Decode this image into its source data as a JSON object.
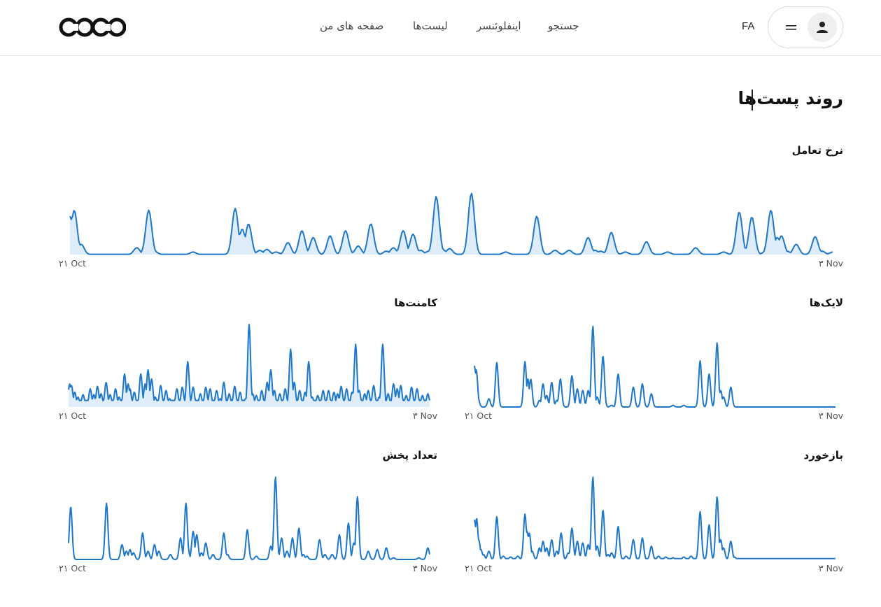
{
  "header": {
    "logo_text": "COCO",
    "nav": {
      "search": "جستجو",
      "influencer": "اینفلوئنسر",
      "lists": "لیست‌ها",
      "my_pages": "صفحه های من"
    },
    "language": "FA",
    "icons": {
      "menu": "hamburger-icon",
      "user": "user-icon"
    }
  },
  "page": {
    "title": "روند پست‌ها"
  },
  "colors": {
    "line": "#1f77c9",
    "fill": "#d6e8f8",
    "accent": "#111111"
  },
  "charts": [
    {
      "id": "engagement",
      "title": "نرخ تعامل",
      "x_start": "۲۱ Oct",
      "x_end": "۳ Nov",
      "chart_data": {
        "type": "area",
        "baseline": 0.3,
        "spikes": [
          [
            0.0,
            45
          ],
          [
            0.006,
            52
          ],
          [
            0.016,
            12
          ],
          [
            0.095,
            8
          ],
          [
            0.112,
            52
          ],
          [
            0.12,
            4
          ],
          [
            0.175,
            3
          ],
          [
            0.235,
            54
          ],
          [
            0.245,
            30
          ],
          [
            0.254,
            36
          ],
          [
            0.27,
            5
          ],
          [
            0.28,
            6
          ],
          [
            0.293,
            3
          ],
          [
            0.31,
            14
          ],
          [
            0.33,
            28
          ],
          [
            0.346,
            20
          ],
          [
            0.37,
            22
          ],
          [
            0.392,
            28
          ],
          [
            0.41,
            10
          ],
          [
            0.428,
            36
          ],
          [
            0.45,
            4
          ],
          [
            0.46,
            8
          ],
          [
            0.474,
            28
          ],
          [
            0.488,
            24
          ],
          [
            0.499,
            5
          ],
          [
            0.51,
            4
          ],
          [
            0.521,
            68
          ],
          [
            0.53,
            6
          ],
          [
            0.54,
            7
          ],
          [
            0.571,
            72
          ],
          [
            0.62,
            3
          ],
          [
            0.664,
            45
          ],
          [
            0.69,
            5
          ],
          [
            0.71,
            5
          ],
          [
            0.737,
            20
          ],
          [
            0.747,
            5
          ],
          [
            0.755,
            4
          ],
          [
            0.77,
            26
          ],
          [
            0.79,
            3
          ],
          [
            0.82,
            15
          ],
          [
            0.85,
            3
          ],
          [
            0.89,
            8
          ],
          [
            0.93,
            3
          ],
          [
            0.952,
            50
          ],
          [
            0.97,
            44
          ],
          [
            0.99,
            4
          ],
          [
            0.997,
            52
          ],
          [
            1.006,
            20
          ],
          [
            1.012,
            22
          ],
          [
            1.02,
            4
          ],
          [
            1.033,
            12
          ],
          [
            1.06,
            21
          ],
          [
            1.07,
            4
          ],
          [
            1.085,
            3
          ]
        ],
        "ylim": [
          0,
          100
        ]
      }
    },
    {
      "id": "likes",
      "title": "لایک‌ها",
      "x_start": "۲۱ Oct",
      "x_end": "۳ Nov",
      "chart_data": {
        "type": "line",
        "baseline": 0,
        "spikes": [
          [
            0.0,
            50
          ],
          [
            0.005,
            45
          ],
          [
            0.01,
            10
          ],
          [
            0.04,
            10
          ],
          [
            0.062,
            54
          ],
          [
            0.14,
            55
          ],
          [
            0.148,
            34
          ],
          [
            0.156,
            34
          ],
          [
            0.18,
            8
          ],
          [
            0.19,
            28
          ],
          [
            0.2,
            14
          ],
          [
            0.214,
            30
          ],
          [
            0.228,
            8
          ],
          [
            0.238,
            34
          ],
          [
            0.27,
            38
          ],
          [
            0.285,
            22
          ],
          [
            0.3,
            20
          ],
          [
            0.315,
            20
          ],
          [
            0.328,
            98
          ],
          [
            0.34,
            12
          ],
          [
            0.356,
            62
          ],
          [
            0.38,
            2
          ],
          [
            0.398,
            40
          ],
          [
            0.44,
            24
          ],
          [
            0.465,
            28
          ],
          [
            0.49,
            16
          ],
          [
            0.55,
            2
          ],
          [
            0.58,
            2
          ],
          [
            0.625,
            56
          ],
          [
            0.65,
            40
          ],
          [
            0.665,
            2
          ],
          [
            0.672,
            78
          ],
          [
            0.682,
            20
          ],
          [
            0.69,
            12
          ],
          [
            0.71,
            24
          ]
        ],
        "ylim": [
          0,
          100
        ]
      }
    },
    {
      "id": "comments",
      "title": "کامنت‌ها",
      "x_start": "۲۱ Oct",
      "x_end": "۳ Nov",
      "chart_data": {
        "type": "area",
        "baseline": 8,
        "spikes": [
          [
            0.003,
            28
          ],
          [
            0.008,
            26
          ],
          [
            0.017,
            18
          ],
          [
            0.026,
            12
          ],
          [
            0.04,
            15
          ],
          [
            0.06,
            22
          ],
          [
            0.07,
            15
          ],
          [
            0.08,
            25
          ],
          [
            0.09,
            16
          ],
          [
            0.104,
            30
          ],
          [
            0.115,
            15
          ],
          [
            0.13,
            22
          ],
          [
            0.14,
            12
          ],
          [
            0.155,
            40
          ],
          [
            0.165,
            28
          ],
          [
            0.17,
            22
          ],
          [
            0.182,
            18
          ],
          [
            0.2,
            40
          ],
          [
            0.212,
            28
          ],
          [
            0.22,
            45
          ],
          [
            0.23,
            34
          ],
          [
            0.24,
            12
          ],
          [
            0.255,
            26
          ],
          [
            0.27,
            20
          ],
          [
            0.28,
            10
          ],
          [
            0.3,
            22
          ],
          [
            0.315,
            24
          ],
          [
            0.33,
            55
          ],
          [
            0.345,
            24
          ],
          [
            0.365,
            16
          ],
          [
            0.38,
            24
          ],
          [
            0.392,
            22
          ],
          [
            0.41,
            20
          ],
          [
            0.42,
            10
          ],
          [
            0.43,
            30
          ],
          [
            0.445,
            16
          ],
          [
            0.46,
            25
          ],
          [
            0.475,
            18
          ],
          [
            0.49,
            10
          ],
          [
            0.5,
            100
          ],
          [
            0.51,
            16
          ],
          [
            0.52,
            14
          ],
          [
            0.535,
            20
          ],
          [
            0.55,
            30
          ],
          [
            0.56,
            45
          ],
          [
            0.57,
            20
          ],
          [
            0.585,
            16
          ],
          [
            0.6,
            22
          ],
          [
            0.615,
            70
          ],
          [
            0.625,
            30
          ],
          [
            0.64,
            20
          ],
          [
            0.655,
            18
          ],
          [
            0.665,
            55
          ],
          [
            0.675,
            12
          ],
          [
            0.69,
            14
          ],
          [
            0.705,
            20
          ],
          [
            0.72,
            20
          ],
          [
            0.735,
            18
          ],
          [
            0.745,
            16
          ],
          [
            0.755,
            25
          ],
          [
            0.77,
            22
          ],
          [
            0.785,
            18
          ],
          [
            0.795,
            76
          ],
          [
            0.805,
            20
          ],
          [
            0.82,
            16
          ],
          [
            0.83,
            20
          ],
          [
            0.845,
            26
          ],
          [
            0.86,
            12
          ],
          [
            0.87,
            76
          ],
          [
            0.885,
            16
          ],
          [
            0.9,
            28
          ],
          [
            0.91,
            22
          ],
          [
            0.92,
            26
          ],
          [
            0.935,
            14
          ],
          [
            0.95,
            24
          ],
          [
            0.965,
            22
          ],
          [
            0.98,
            14
          ],
          [
            0.995,
            16
          ]
        ],
        "ylim": [
          0,
          100
        ]
      }
    },
    {
      "id": "feedback",
      "title": "بازخورد",
      "x_start": "۲۱ Oct",
      "x_end": "۳ Nov",
      "chart_data": {
        "type": "line",
        "baseline": 1,
        "spikes": [
          [
            0.0,
            48
          ],
          [
            0.006,
            50
          ],
          [
            0.012,
            24
          ],
          [
            0.018,
            12
          ],
          [
            0.025,
            6
          ],
          [
            0.04,
            10
          ],
          [
            0.062,
            52
          ],
          [
            0.08,
            4
          ],
          [
            0.1,
            3
          ],
          [
            0.12,
            4
          ],
          [
            0.14,
            55
          ],
          [
            0.146,
            34
          ],
          [
            0.152,
            32
          ],
          [
            0.16,
            10
          ],
          [
            0.18,
            14
          ],
          [
            0.19,
            22
          ],
          [
            0.2,
            14
          ],
          [
            0.214,
            24
          ],
          [
            0.228,
            10
          ],
          [
            0.24,
            32
          ],
          [
            0.26,
            8
          ],
          [
            0.27,
            38
          ],
          [
            0.285,
            22
          ],
          [
            0.3,
            20
          ],
          [
            0.315,
            18
          ],
          [
            0.328,
            100
          ],
          [
            0.34,
            16
          ],
          [
            0.356,
            60
          ],
          [
            0.37,
            6
          ],
          [
            0.38,
            8
          ],
          [
            0.398,
            40
          ],
          [
            0.42,
            4
          ],
          [
            0.44,
            24
          ],
          [
            0.465,
            26
          ],
          [
            0.49,
            16
          ],
          [
            0.51,
            4
          ],
          [
            0.53,
            3
          ],
          [
            0.55,
            2
          ],
          [
            0.58,
            3
          ],
          [
            0.6,
            4
          ],
          [
            0.625,
            58
          ],
          [
            0.65,
            42
          ],
          [
            0.665,
            4
          ],
          [
            0.672,
            76
          ],
          [
            0.682,
            24
          ],
          [
            0.69,
            14
          ],
          [
            0.71,
            22
          ],
          [
            0.72,
            3
          ]
        ],
        "ylim": [
          0,
          100
        ]
      }
    },
    {
      "id": "shares",
      "title": "تعداد پخش",
      "x_start": "۲۱ Oct",
      "x_end": "۳ Nov",
      "chart_data": {
        "type": "line",
        "baseline": 0,
        "spikes": [
          [
            0.006,
            64
          ],
          [
            0.105,
            68
          ],
          [
            0.148,
            18
          ],
          [
            0.16,
            10
          ],
          [
            0.17,
            12
          ],
          [
            0.18,
            8
          ],
          [
            0.205,
            32
          ],
          [
            0.22,
            10
          ],
          [
            0.238,
            18
          ],
          [
            0.25,
            10
          ],
          [
            0.282,
            6
          ],
          [
            0.31,
            26
          ],
          [
            0.325,
            68
          ],
          [
            0.33,
            14
          ],
          [
            0.345,
            34
          ],
          [
            0.355,
            30
          ],
          [
            0.368,
            8
          ],
          [
            0.38,
            20
          ],
          [
            0.4,
            6
          ],
          [
            0.43,
            32
          ],
          [
            0.44,
            6
          ],
          [
            0.495,
            36
          ],
          [
            0.52,
            4
          ],
          [
            0.56,
            16
          ],
          [
            0.573,
            100
          ],
          [
            0.59,
            26
          ],
          [
            0.605,
            10
          ],
          [
            0.62,
            26
          ],
          [
            0.638,
            38
          ],
          [
            0.65,
            6
          ],
          [
            0.66,
            4
          ],
          [
            0.695,
            24
          ],
          [
            0.71,
            6
          ],
          [
            0.73,
            6
          ],
          [
            0.75,
            30
          ],
          [
            0.775,
            44
          ],
          [
            0.79,
            20
          ],
          [
            0.8,
            76
          ],
          [
            0.83,
            10
          ],
          [
            0.855,
            12
          ],
          [
            0.88,
            14
          ],
          [
            0.9,
            2
          ],
          [
            0.97,
            2
          ],
          [
            0.995,
            14
          ]
        ],
        "ylim": [
          0,
          100
        ]
      }
    }
  ]
}
